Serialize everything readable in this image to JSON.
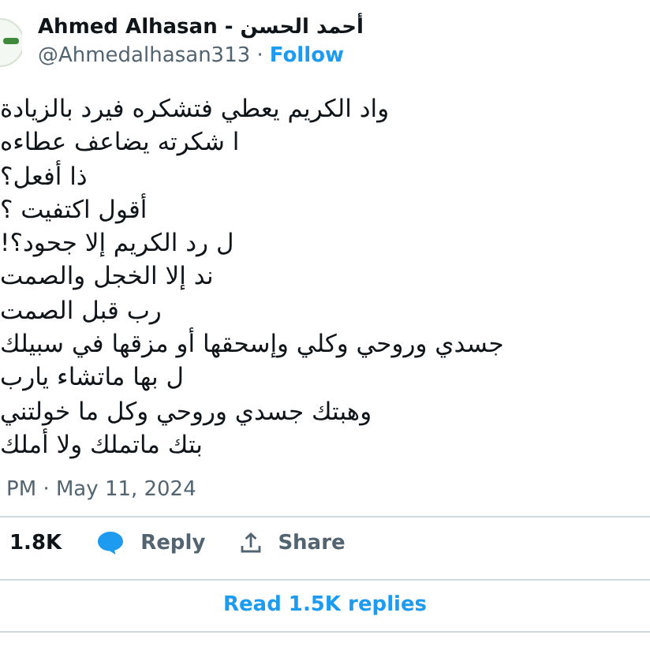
{
  "author": {
    "name": "Ahmed Alhasan - أحمد الحسن",
    "handle": "@Ahmedalhasan313 ·",
    "follow": "Follow"
  },
  "lines": [
    "واد الكريم يعطي فتشكره فيرد بالزيادة",
    "ا شكرته يضاعف عطاءه",
    "ذا أفعل؟",
    "أقول اكتفيت ؟",
    "ل رد الكريم إلا جحود؟!",
    "ند إلا الخجل والصمت",
    "رب قبل الصمت",
    "جسدي وروحي وكلي وإسحقها أو مزقها في سبيلك",
    "ل بها ماتشاء يارب",
    "وهبتك جسدي وروحي وكل ما خولتني",
    "بتك ماتملك ولا أملك"
  ],
  "timestamp": "PM · May 11, 2024",
  "actions": {
    "likes": "1.8K",
    "reply": "Reply",
    "share": "Share"
  },
  "read_replies": "Read 1.5K replies"
}
